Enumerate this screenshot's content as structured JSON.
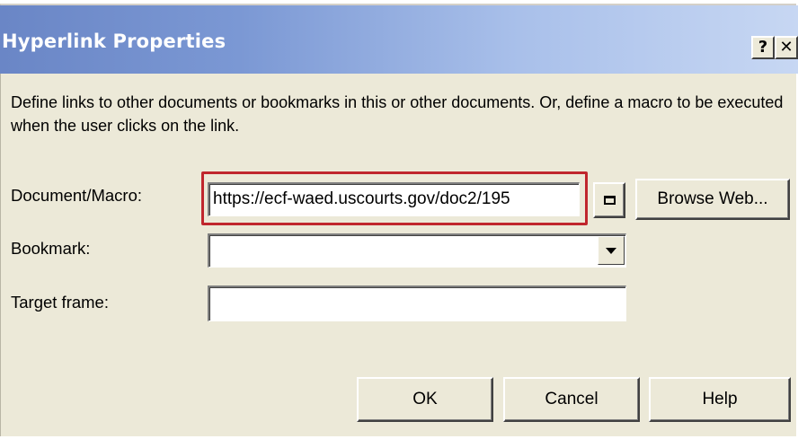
{
  "dialog": {
    "title": "Hyperlink Properties",
    "help_glyph": "?",
    "close_glyph": "✕",
    "description": "Define links to other documents or bookmarks in this or other documents. Or, define a macro to be executed when the user clicks on the link."
  },
  "fields": {
    "document_macro": {
      "label": "Document/Macro:",
      "value": "https://ecf-waed.uscourts.gov/doc2/195"
    },
    "bookmark": {
      "label": "Bookmark:",
      "value": ""
    },
    "target_frame": {
      "label": "Target frame:",
      "value": ""
    }
  },
  "buttons": {
    "browse_web": "Browse Web...",
    "ok": "OK",
    "cancel": "Cancel",
    "help": "Help"
  },
  "colors": {
    "highlight_box": "#c0262d",
    "titlebar_start": "#6a86c6",
    "dialog_face": "#ece9d8"
  }
}
